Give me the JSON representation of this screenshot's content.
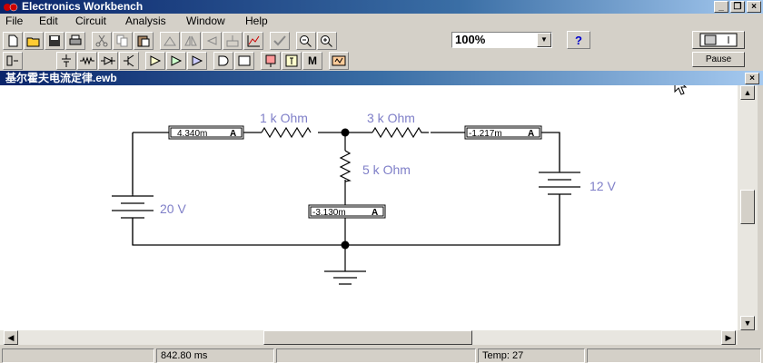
{
  "app": {
    "title": "Electronics Workbench"
  },
  "menu": [
    "File",
    "Edit",
    "Circuit",
    "Analysis",
    "Window",
    "Help"
  ],
  "toolbar": {
    "zoom": "100%",
    "help": "?"
  },
  "sim": {
    "pause_label": "Pause"
  },
  "document": {
    "title": "基尔霍夫电流定律.ewb"
  },
  "circuit": {
    "resistors": [
      {
        "label": "1 k Ohm"
      },
      {
        "label": "3 k Ohm"
      },
      {
        "label": "5 k Ohm"
      }
    ],
    "sources": [
      {
        "label": "20 V"
      },
      {
        "label": "12 V"
      }
    ],
    "ammeters": [
      {
        "value": "4.340m",
        "unit": "A"
      },
      {
        "value": "-1.217m",
        "unit": "A"
      },
      {
        "value": "-3.130m",
        "unit": "A"
      }
    ]
  },
  "status": {
    "time": "842.80 ms",
    "temp": "Temp:  27"
  }
}
